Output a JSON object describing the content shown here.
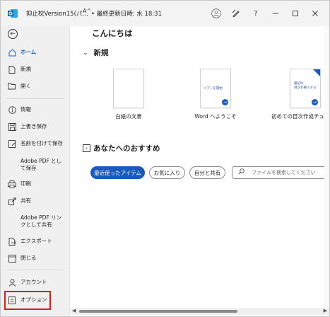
{
  "window": {
    "app_icon": "outlook-icon",
    "title": "抑止枕Version15(パ…",
    "modified_label": "• 最終更新日時: 水 18:31",
    "title_buttons": [
      "person-icon",
      "pen-icon",
      "help-icon",
      "minimize-icon",
      "restore-icon",
      "close-icon"
    ],
    "help_label": "?",
    "autosave_glyph": "A^"
  },
  "sidebar": {
    "items": [
      {
        "label": "ホーム",
        "icon": "home-icon",
        "active": true
      },
      {
        "label": "新規",
        "icon": "new-file-icon"
      },
      {
        "label": "開く",
        "icon": "folder-open-icon"
      },
      {
        "label": "情報",
        "icon": "info-icon"
      },
      {
        "label": "上書き保存",
        "icon": "save-icon"
      },
      {
        "label": "名前を付けて保存",
        "icon": "save-as-icon"
      },
      {
        "label": "Adobe PDF として保存",
        "icon": ""
      },
      {
        "label": "印刷",
        "icon": "print-icon"
      },
      {
        "label": "共有",
        "icon": "share-icon"
      },
      {
        "label": "Adobe PDF リンクとして共有",
        "icon": ""
      },
      {
        "label": "エクスポート",
        "icon": "export-icon"
      },
      {
        "label": "閉じる",
        "icon": "close-doc-icon"
      },
      {
        "label": "アカウント",
        "icon": "account-icon"
      },
      {
        "label": "オプション",
        "icon": "options-icon"
      }
    ]
  },
  "main": {
    "greeting": "こんにちは",
    "new_section": "新規",
    "templates": [
      {
        "caption": "白紙の文書"
      },
      {
        "caption": "Word へようこそ",
        "thumb_text": "ツアーを開始"
      },
      {
        "caption": "初めての目次作成チュート",
        "thumb_text_1": "最初の",
        "thumb_text_2": "目次を挿入する"
      }
    ],
    "recommend_section": "あなたへのおすすめ",
    "filters": [
      "最近使ったアイテム",
      "お気に入り",
      "自分と共有"
    ],
    "search_placeholder": "ファイルを検索してください"
  },
  "colors": {
    "accent": "#185abd",
    "highlight_box": "#d81e1e"
  }
}
